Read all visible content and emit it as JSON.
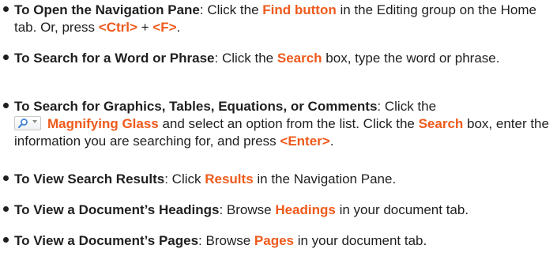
{
  "items": [
    {
      "title": "To Open the Navigation Pane",
      "sep": ": Click the ",
      "hl1": "Find button",
      "t2": " in the Editing group on the Home tab.  Or, press ",
      "hl2": "<Ctrl>",
      "t3": " + ",
      "hl3": "<F>",
      "t4": "."
    },
    {
      "title": "To Search for a Word or Phrase",
      "sep": ": Click the ",
      "hl1": "Search",
      "t2": " box, type the word or phrase."
    },
    {
      "title": "To Search for Graphics, Tables, Equations, or Comments",
      "sep": ": Click the",
      "icon": "magnifying-glass-dropdown-icon",
      "hl1": "Magnifying Glass",
      "t2": " and select an option from the list. Click the ",
      "hl2": "Search",
      "t3": " box, enter the information you are searching for, and press ",
      "hl3": "<Enter>",
      "t4": "."
    },
    {
      "title": "To View Search Results",
      "sep": ": Click ",
      "hl1": "Results",
      "t2": " in the Navigation Pane."
    },
    {
      "title": "To View a Document’s Headings",
      "sep": ":  Browse ",
      "hl1": "Headings",
      "t2": " in your document tab."
    },
    {
      "title": "To View a Document’s Pages",
      "sep": ": Browse ",
      "hl1": "Pages",
      "t2": " in your document tab."
    }
  ],
  "colors": {
    "highlight": "#ee5a1c",
    "text": "#1f1f1f"
  }
}
